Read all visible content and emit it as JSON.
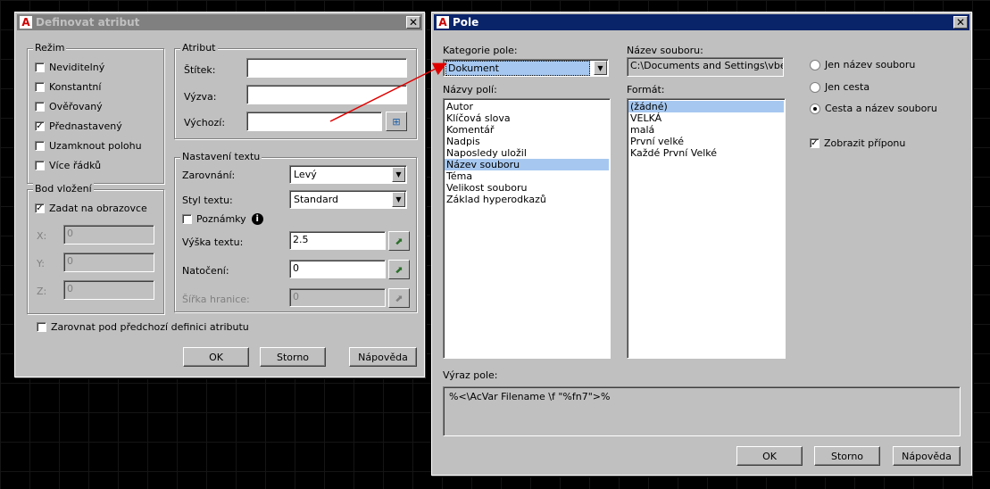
{
  "attr_dialog": {
    "title": "Definovat atribut",
    "mode": {
      "legend": "Režim",
      "items": [
        {
          "label": "Neviditelný",
          "checked": false
        },
        {
          "label": "Konstantní",
          "checked": false
        },
        {
          "label": "Ověřovaný",
          "checked": false
        },
        {
          "label": "Přednastavený",
          "checked": true
        },
        {
          "label": "Uzamknout polohu",
          "checked": false
        },
        {
          "label": "Více řádků",
          "checked": false
        }
      ]
    },
    "attribute": {
      "legend": "Atribut",
      "tag_label": "Štítek:",
      "prompt_label": "Výzva:",
      "default_label": "Výchozí:",
      "tag_value": "",
      "prompt_value": "",
      "default_value": ""
    },
    "insertion": {
      "legend": "Bod vložení",
      "on_screen_label": "Zadat na obrazovce",
      "on_screen_checked": true,
      "x_label": "X:",
      "y_label": "Y:",
      "z_label": "Z:",
      "x_value": "0",
      "y_value": "0",
      "z_value": "0"
    },
    "text_settings": {
      "legend": "Nastavení textu",
      "justification_label": "Zarovnání:",
      "justification_value": "Levý",
      "style_label": "Styl textu:",
      "style_value": "Standard",
      "annotative_label": "Poznámky",
      "height_label": "Výška textu:",
      "height_value": "2.5",
      "rotation_label": "Natočení:",
      "rotation_value": "0",
      "boundary_label": "Šířka hranice:",
      "boundary_value": "0"
    },
    "align_below_label": "Zarovnat pod předchozí definici atributu",
    "ok_label": "OK",
    "cancel_label": "Storno",
    "help_label": "Nápověda"
  },
  "field_dialog": {
    "title": "Pole",
    "category_label": "Kategorie pole:",
    "category_value": "Dokument",
    "field_names_label": "Názvy polí:",
    "field_names": [
      "Autor",
      "Klíčová slova",
      "Komentář",
      "Nadpis",
      "Naposledy uložil",
      "Název souboru",
      "Téma",
      "Velikost souboru",
      "Základ hyperodkazů"
    ],
    "field_names_selected": 5,
    "filename_label": "Název souboru:",
    "filename_value": "C:\\Documents and Settings\\vbehu",
    "format_label": "Formát:",
    "formats": [
      "(žádné)",
      "VELKÁ",
      "malá",
      "První velké",
      "Každé První Velké"
    ],
    "formats_selected": 0,
    "radios": [
      {
        "label": "Jen název souboru",
        "checked": false
      },
      {
        "label": "Jen cesta",
        "checked": false
      },
      {
        "label": "Cesta a název souboru",
        "checked": true
      }
    ],
    "show_ext_label": "Zobrazit příponu",
    "show_ext_checked": true,
    "expression_label": "Výraz pole:",
    "expression_value": "%<\\AcVar Filename \\f \"%fn7\">%",
    "ok_label": "OK",
    "cancel_label": "Storno",
    "help_label": "Nápověda"
  },
  "colors": {
    "active_title": "#0a246a",
    "inactive_title": "#808080",
    "selection": "#a6c8f0",
    "arrow": "#e00000"
  }
}
